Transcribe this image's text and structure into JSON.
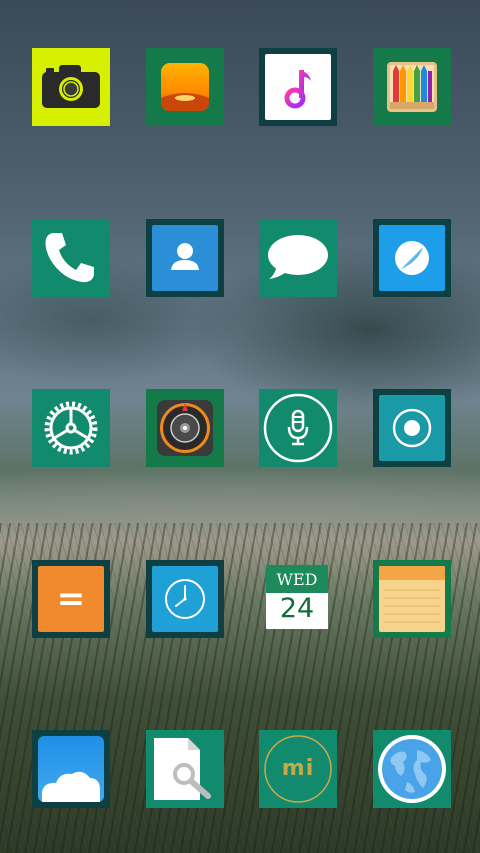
{
  "home_screen": {
    "apps": [
      {
        "name": "camera",
        "icon": "camera-icon"
      },
      {
        "name": "gallery",
        "icon": "gallery-icon"
      },
      {
        "name": "music",
        "icon": "music-note-icon"
      },
      {
        "name": "themes",
        "icon": "colored-pencils-icon"
      },
      {
        "name": "phone",
        "icon": "phone-handset-icon"
      },
      {
        "name": "contacts",
        "icon": "contact-person-icon"
      },
      {
        "name": "messaging",
        "icon": "speech-bubble-icon"
      },
      {
        "name": "browser",
        "icon": "compass-circle-icon"
      },
      {
        "name": "settings",
        "icon": "gear-icon"
      },
      {
        "name": "compass",
        "icon": "compass-dial-icon"
      },
      {
        "name": "recorder",
        "icon": "microphone-icon"
      },
      {
        "name": "screen-recorder",
        "icon": "record-dot-icon"
      },
      {
        "name": "calculator",
        "icon": "equals-icon"
      },
      {
        "name": "clock",
        "icon": "clock-icon"
      },
      {
        "name": "calendar",
        "icon": "calendar-icon"
      },
      {
        "name": "notes",
        "icon": "notepad-icon"
      },
      {
        "name": "cloud",
        "icon": "cloud-icon"
      },
      {
        "name": "file-explorer",
        "icon": "document-search-icon"
      },
      {
        "name": "mi-store",
        "icon": "mi-logo-icon"
      },
      {
        "name": "world-browser",
        "icon": "globe-icon"
      }
    ],
    "calendar": {
      "day": "WED",
      "date": "24"
    },
    "calculator_symbol": "=",
    "mi_logo_text": "mi"
  },
  "colors": {
    "frame_dark": "#0d3f43",
    "frame_green": "#147a4a",
    "frame_teal": "#128a6e",
    "camera_bg": "#d6f000",
    "contacts_blue": "#2a8fd6",
    "calculator_orange": "#f08a2c",
    "notes_yellow": "#f7d28a"
  }
}
